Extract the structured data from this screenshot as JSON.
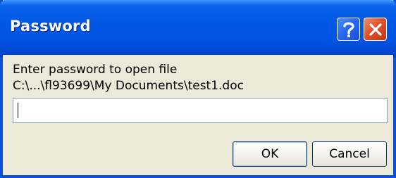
{
  "window": {
    "title": "Password",
    "help_label": "?",
    "close_label": "Close"
  },
  "dialog": {
    "prompt": "Enter password to open file",
    "file_path": "C:\\...\\fl93699\\My Documents\\test1.doc"
  },
  "password_input": {
    "value": "",
    "placeholder": ""
  },
  "buttons": {
    "ok_label": "OK",
    "cancel_label": "Cancel"
  },
  "icons": {
    "help": "help-icon",
    "close": "close-icon"
  },
  "colors": {
    "titlebar": "#0058e6",
    "window_border": "#0a50d8",
    "face": "#ece9d8",
    "close_button": "#e0522c",
    "help_button": "#2766ee"
  }
}
